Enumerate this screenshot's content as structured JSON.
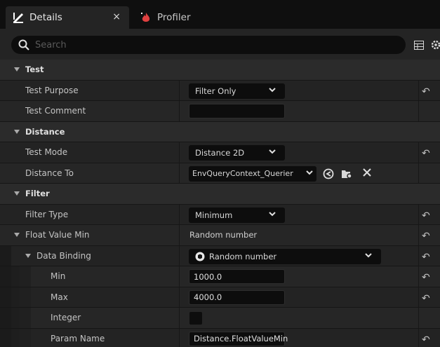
{
  "tabs": [
    {
      "label": "Details",
      "icon": "details-pencil-icon",
      "active": true
    },
    {
      "label": "Profiler",
      "icon": "profiler-flame-icon",
      "active": false
    }
  ],
  "tab_close_glyph": "×",
  "search": {
    "placeholder": "Search"
  },
  "categories": {
    "test": "Test",
    "distance": "Distance",
    "filter": "Filter"
  },
  "rows": {
    "test_purpose": {
      "label": "Test Purpose",
      "value": "Filter Only"
    },
    "test_comment": {
      "label": "Test Comment",
      "value": ""
    },
    "test_mode": {
      "label": "Test Mode",
      "value": "Distance 2D"
    },
    "distance_to": {
      "label": "Distance To",
      "value": "EnvQueryContext_Querier"
    },
    "filter_type": {
      "label": "Filter Type",
      "value": "Minimum"
    },
    "float_value_min": {
      "label": "Float Value Min",
      "value": "Random number"
    },
    "data_binding": {
      "label": "Data Binding",
      "value": "Random number"
    },
    "min": {
      "label": "Min",
      "value": "1000.0"
    },
    "max": {
      "label": "Max",
      "value": "4000.0"
    },
    "integer": {
      "label": "Integer",
      "checked": false
    },
    "param_name": {
      "label": "Param Name",
      "value": "Distance.FloatValueMin"
    }
  },
  "reset_glyph": "↶",
  "colors": {
    "accent": "#e0e0e0",
    "profiler_icon": "#e04040"
  }
}
